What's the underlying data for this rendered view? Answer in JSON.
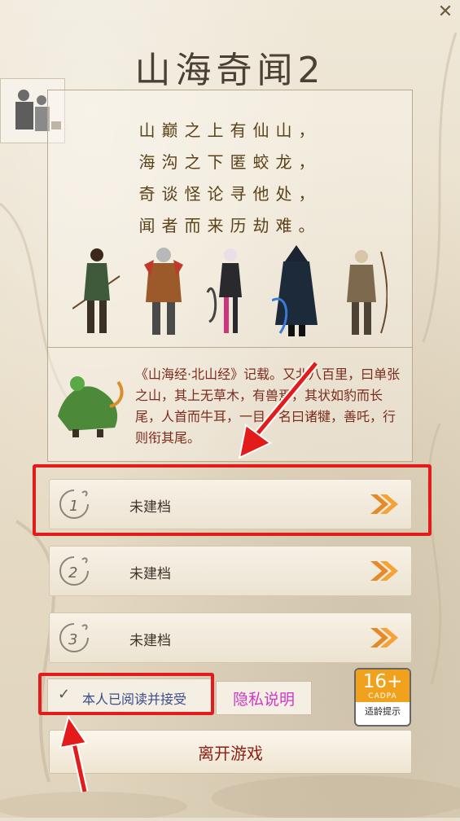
{
  "title": "山海奇闻2",
  "close_icon": "close-icon",
  "intro": {
    "poem": [
      "山巅之上有仙山，",
      "海沟之下匿蛟龙，",
      "奇谈怪论寻他处，",
      "闻者而来历劫难。"
    ]
  },
  "lore": {
    "text": "《山海经·北山经》记载。又北八百里，曰单张之山，其上无草木，有兽焉，其状如豹而长尾，人首而牛耳，一目，名曰诸犍，善吒，行则衔其尾。"
  },
  "save_slots": [
    {
      "label": "未建档"
    },
    {
      "label": "未建档"
    },
    {
      "label": "未建档"
    }
  ],
  "agreement": {
    "check_mark": "✓",
    "label": "本人已阅读并接受"
  },
  "privacy": {
    "label": "隐私说明"
  },
  "age_rating": {
    "value": "16+",
    "org": "CADPA",
    "caption": "适龄提示"
  },
  "exit": {
    "label": "离开游戏"
  },
  "colors": {
    "highlight": "#e31b1b",
    "accent_orange": "#f1a21c",
    "privacy_text": "#cf39c6",
    "exit_text": "#8d1f12"
  }
}
